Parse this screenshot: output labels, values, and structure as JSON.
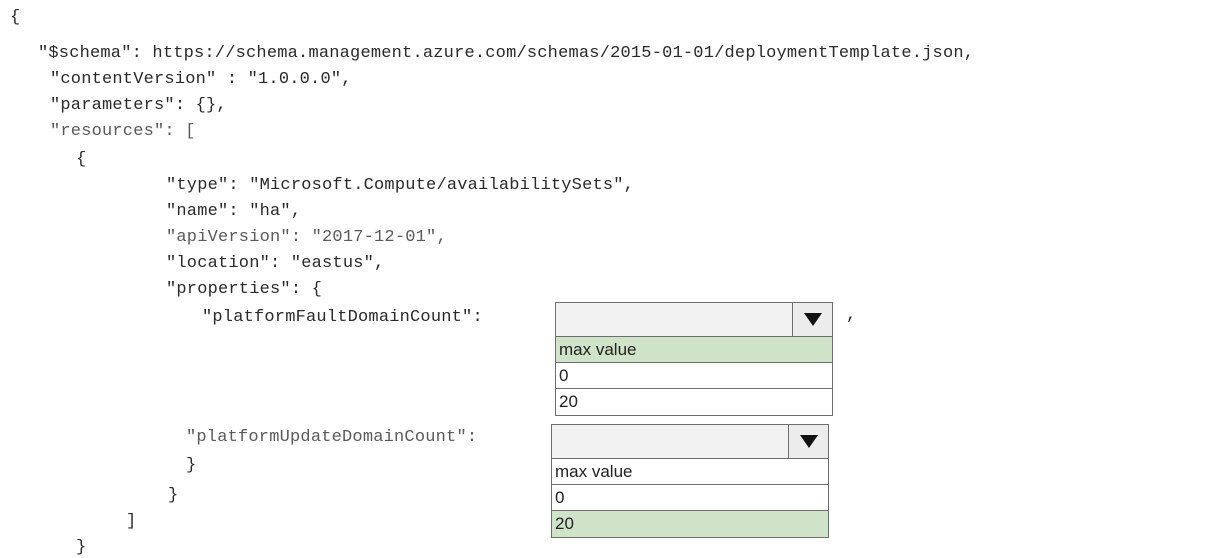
{
  "code_lines": [
    "{",
    "\"$schema\": https://schema.management.azure.com/schemas/2015-01-01/deploymentTemplate.json,",
    "\"contentVersion\" : \"1.0.0.0\",",
    "\"parameters\": {},",
    "\"resources\": [",
    "{",
    "\"type\": \"Microsoft.Compute/availabilitySets\",",
    "\"name\": \"ha\",",
    "\"apiVersion\": \"2017-12-01\",",
    "\"location\": \"eastus\",",
    "\"properties\": {",
    "\"platformFaultDomainCount\":",
    ",",
    "\"platformUpdateDomainCount\":",
    "}",
    "}",
    "]",
    "}"
  ],
  "dropdowns": {
    "fault_domain": {
      "selected": "",
      "options": [
        "max value",
        "0",
        "20"
      ],
      "highlighted_option": "max value"
    },
    "update_domain": {
      "selected": "",
      "options": [
        "max value",
        "0",
        "20"
      ],
      "highlighted_option": "20"
    }
  }
}
